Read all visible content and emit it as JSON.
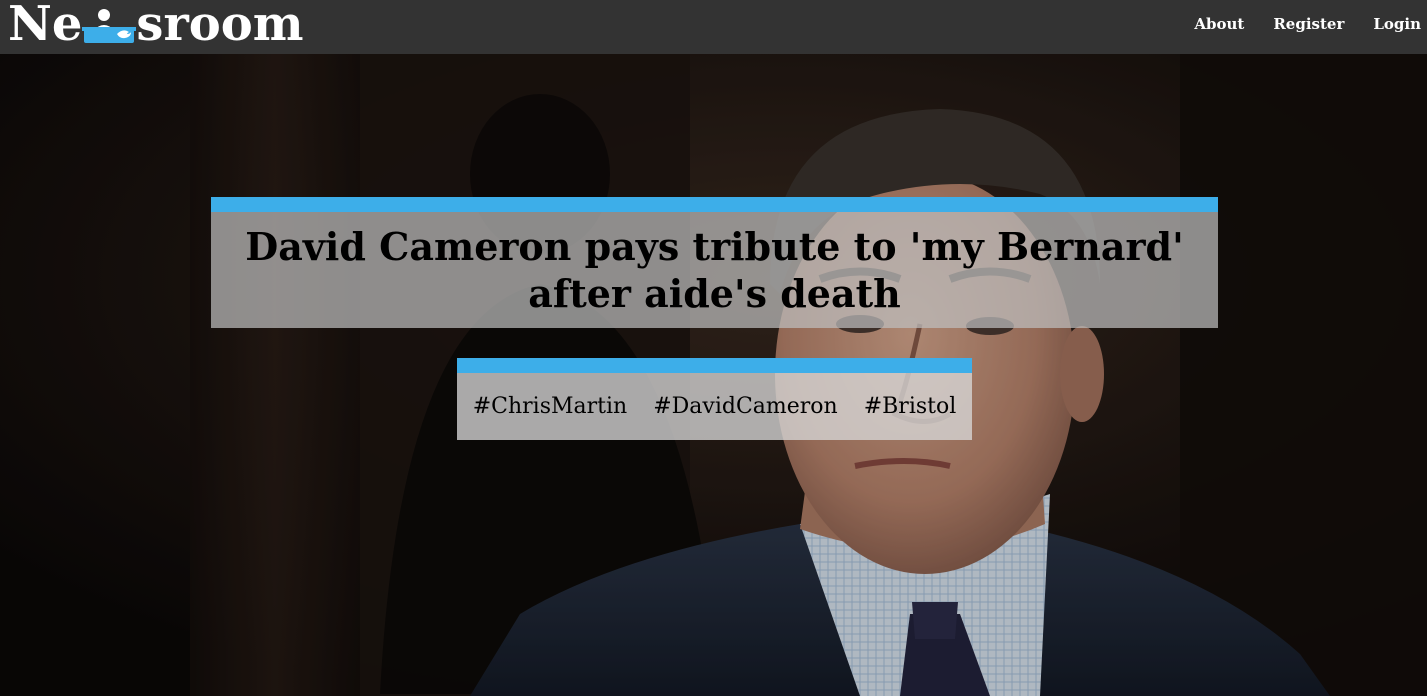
{
  "brand": {
    "name_prefix": "Ne",
    "name_suffix": "sroom",
    "logo_icon": "desk-with-bird-icon",
    "accent_color": "#3daee9"
  },
  "nav": {
    "items": [
      {
        "label": "About"
      },
      {
        "label": "Register"
      },
      {
        "label": "Login"
      }
    ]
  },
  "article": {
    "headline": "David Cameron pays tribute to 'my Bernard' after aide's death",
    "hero_image": "photo-of-man-in-suit",
    "tags": [
      {
        "label": "#ChrisMartin"
      },
      {
        "label": "#DavidCameron"
      },
      {
        "label": "#Bristol"
      }
    ]
  }
}
